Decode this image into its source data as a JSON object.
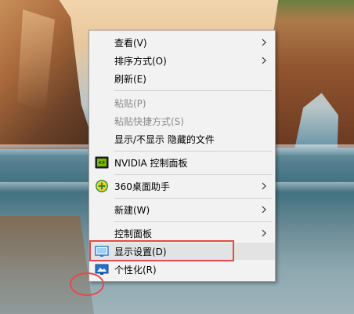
{
  "context_menu": {
    "items": [
      {
        "label": "查看(V)",
        "icon": "",
        "submenu": true,
        "disabled": false
      },
      {
        "label": "排序方式(O)",
        "icon": "",
        "submenu": true,
        "disabled": false
      },
      {
        "label": "刷新(E)",
        "icon": "",
        "submenu": false,
        "disabled": false
      },
      {
        "label": "粘贴(P)",
        "icon": "",
        "submenu": false,
        "disabled": true
      },
      {
        "label": "粘贴快捷方式(S)",
        "icon": "",
        "submenu": false,
        "disabled": true
      },
      {
        "label": "显示/不显示 隐藏的文件",
        "icon": "",
        "submenu": false,
        "disabled": false
      },
      {
        "label": "NVIDIA 控制面板",
        "icon": "nvidia-icon",
        "submenu": false,
        "disabled": false
      },
      {
        "label": "360桌面助手",
        "icon": "360-desktop-assistant-icon",
        "submenu": true,
        "disabled": false
      },
      {
        "label": "新建(W)",
        "icon": "",
        "submenu": true,
        "disabled": false
      },
      {
        "label": "控制面板",
        "icon": "",
        "submenu": true,
        "disabled": false
      },
      {
        "label": "显示设置(D)",
        "icon": "display-settings-icon",
        "submenu": false,
        "disabled": false,
        "hovered": true
      },
      {
        "label": "个性化(R)",
        "icon": "personalize-icon",
        "submenu": false,
        "disabled": false
      }
    ]
  },
  "annotations": {
    "highlight_color": "#e34a4a",
    "highlight_target": "显示设置(D)"
  },
  "colors": {
    "menu_bg": "#f2f2f2",
    "hover_bg": "#e3e3e3",
    "disabled_text": "#8a8a8a",
    "separator": "#d0d0d0"
  }
}
